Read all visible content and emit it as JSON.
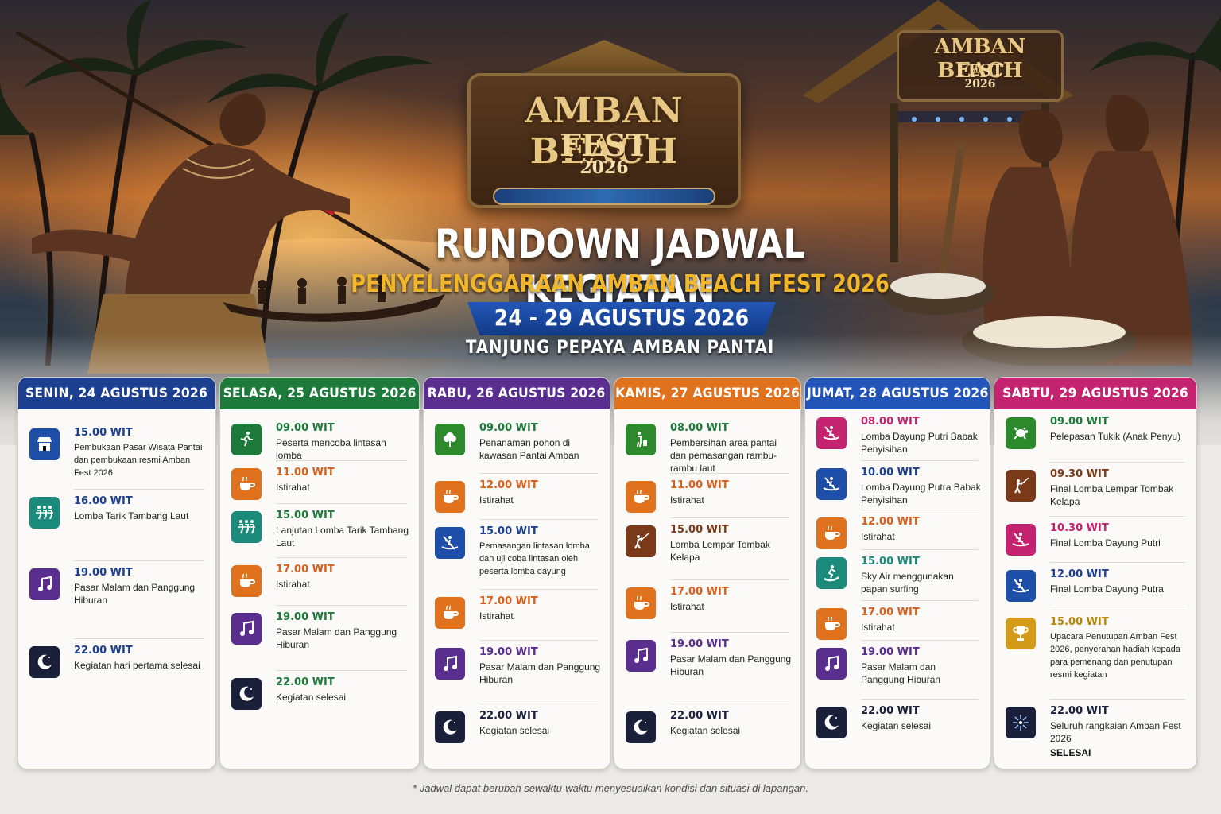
{
  "logo": {
    "line1": "AMBAN BEACH",
    "line2": "FEST",
    "line3": "2026"
  },
  "stage_sign": {
    "line1": "AMBAN BEACH",
    "line2": "FEST",
    "line3": "2026"
  },
  "header": {
    "title": "RUNDOWN JADWAL KEGIATAN",
    "subtitle": "PENYELENGGARAAN AMBAN BEACH FEST 2026",
    "dates": "24 - 29 AGUSTUS 2026",
    "location": "TANJUNG PEPAYA AMBAN PANTAI"
  },
  "colors": {
    "senin": "#1d3f8f",
    "selasa": "#1e7a3a",
    "rabu": "#5a2e8e",
    "kamis": "#e0711d",
    "jumat": "#2354b8",
    "sabtu": "#c4236f",
    "time_blue": "#1d3f8f",
    "time_green": "#1e7a3a",
    "time_orange": "#d8601a",
    "time_purple": "#5a2e8e",
    "time_red": "#c4236f"
  },
  "days": [
    {
      "header": "SENIN, 24 AGUSTUS 2026",
      "events": [
        {
          "time": "15.00 WIT",
          "desc": "Pembukaan Pasar Wisata Pantai dan pembukaan resmi Amban Fest 2026.",
          "icon": "market-stall-icon"
        },
        {
          "time": "16.00 WIT",
          "desc": "Lomba Tarik Tambang Laut",
          "icon": "tug-of-war-icon"
        },
        {
          "time": "19.00 WIT",
          "desc": "Pasar Malam dan Panggung Hiburan",
          "icon": "music-note-icon"
        },
        {
          "time": "22.00 WIT",
          "desc": "Kegiatan hari pertama selesai",
          "icon": "moon-icon"
        }
      ]
    },
    {
      "header": "SELASA, 25 AGUSTUS 2026",
      "events": [
        {
          "time": "09.00 WIT",
          "desc": "Peserta mencoba lintasan lomba",
          "icon": "runner-icon"
        },
        {
          "time": "11.00 WIT",
          "desc": "Istirahat",
          "icon": "coffee-cup-icon"
        },
        {
          "time": "15.00 WIT",
          "desc": "Lanjutan Lomba Tarik Tambang Laut",
          "icon": "tug-of-war-icon"
        },
        {
          "time": "17.00 WIT",
          "desc": "Istirahat",
          "icon": "coffee-cup-icon"
        },
        {
          "time": "19.00 WIT",
          "desc": "Pasar Malam dan Panggung Hiburan",
          "icon": "music-note-icon"
        },
        {
          "time": "22.00 WIT",
          "desc": "Kegiatan selesai",
          "icon": "moon-icon"
        }
      ]
    },
    {
      "header": "RABU, 26 AGUSTUS 2026",
      "events": [
        {
          "time": "09.00 WIT",
          "desc": "Penanaman pohon di kawasan Pantai Amban",
          "icon": "tree-icon"
        },
        {
          "time": "12.00 WIT",
          "desc": "Istirahat",
          "icon": "coffee-cup-icon"
        },
        {
          "time": "15.00 WIT",
          "desc": "Pemasangan lintasan lomba dan uji coba lintasan oleh peserta lomba dayung",
          "icon": "rowing-icon"
        },
        {
          "time": "17.00 WIT",
          "desc": "Istirahat",
          "icon": "coffee-cup-icon"
        },
        {
          "time": "19.00 WIT",
          "desc": "Pasar Malam dan Panggung Hiburan",
          "icon": "music-note-icon"
        },
        {
          "time": "22.00 WIT",
          "desc": "Kegiatan selesai",
          "icon": "moon-icon"
        }
      ]
    },
    {
      "header": "KAMIS, 27 AGUSTUS 2026",
      "events": [
        {
          "time": "08.00 WIT",
          "desc": "Pembersihan area pantai dan pemasangan rambu-rambu laut",
          "icon": "cleaning-person-icon"
        },
        {
          "time": "11.00 WIT",
          "desc": "Istirahat",
          "icon": "coffee-cup-icon"
        },
        {
          "time": "15.00 WIT",
          "desc": "Lomba Lempar Tombak Kelapa",
          "icon": "spear-throw-icon"
        },
        {
          "time": "17.00 WIT",
          "desc": "Istirahat",
          "icon": "coffee-cup-icon"
        },
        {
          "time": "19.00 WIT",
          "desc": "Pasar Malam dan Panggung Hiburan",
          "icon": "music-note-icon"
        },
        {
          "time": "22.00 WIT",
          "desc": "Kegiatan selesai",
          "icon": "moon-icon"
        }
      ]
    },
    {
      "header": "JUMAT, 28 AGUSTUS 2026",
      "events": [
        {
          "time": "08.00 WIT",
          "desc": "Lomba Dayung Putri Babak Penyisihan",
          "icon": "rowing-icon"
        },
        {
          "time": "10.00 WIT",
          "desc": "Lomba Dayung Putra Babak Penyisihan",
          "icon": "rowing-icon"
        },
        {
          "time": "12.00 WIT",
          "desc": "Istirahat",
          "icon": "coffee-cup-icon"
        },
        {
          "time": "15.00 WIT",
          "desc": "Sky Air menggunakan papan surfing",
          "icon": "surfer-icon"
        },
        {
          "time": "17.00 WIT",
          "desc": "Istirahat",
          "icon": "coffee-cup-icon"
        },
        {
          "time": "19.00 WIT",
          "desc": "Pasar Malam dan Panggung Hiburan",
          "icon": "music-note-icon"
        },
        {
          "time": "22.00 WIT",
          "desc": "Kegiatan selesai",
          "icon": "moon-icon"
        }
      ]
    },
    {
      "header": "SABTU, 29 AGUSTUS 2026",
      "events": [
        {
          "time": "09.00 WIT",
          "desc": "Pelepasan Tukik (Anak Penyu)",
          "icon": "turtle-icon"
        },
        {
          "time": "09.30 WIT",
          "desc": "Final Lomba Lempar Tombak Kelapa",
          "icon": "spear-throw-icon"
        },
        {
          "time": "10.30 WIT",
          "desc": "Final Lomba Dayung Putri",
          "icon": "rowing-icon"
        },
        {
          "time": "12.00 WIT",
          "desc": "Final Lomba Dayung Putra",
          "icon": "rowing-icon"
        },
        {
          "time": "15.00 WIT",
          "desc": "Upacara Penutupan Amban Fest 2026, penyerahan hadiah kepada para pemenang dan penutupan resmi kegiatan",
          "icon": "trophy-icon"
        },
        {
          "time": "22.00 WIT",
          "desc": "Seluruh rangkaian Amban Fest 2026",
          "extra": "SELESAI",
          "icon": "fireworks-icon"
        }
      ]
    }
  ],
  "footnote": "* Jadwal dapat berubah sewaktu-waktu menyesuaikan kondisi dan situasi di lapangan."
}
